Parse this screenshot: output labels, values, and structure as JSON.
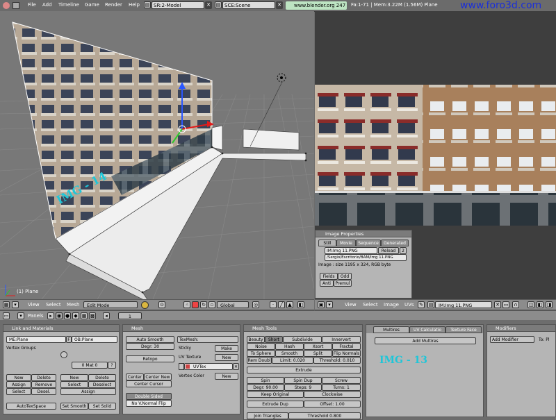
{
  "topbar": {
    "menus": [
      "File",
      "Add",
      "Timeline",
      "Game",
      "Render",
      "Help"
    ],
    "screen": "SR:2-Model",
    "scene": "SCE:Scene",
    "url": "www.blender.org 247",
    "stats": "Fa:1-71 | Mem:3.22M (1.56M) Plane",
    "watermark": "www.foro3d.com"
  },
  "view3d": {
    "overlay_text": "IMG - 14",
    "object_label": "(1) Plane",
    "header": {
      "view": "View",
      "select": "Select",
      "mesh": "Mesh",
      "mode": "Edit Mode",
      "orientation": "Global"
    }
  },
  "imageview": {
    "header": {
      "view": "View",
      "select": "Select",
      "image": "Image",
      "uvs": "UVs",
      "image_name": "IM:Img 11.PNG"
    },
    "properties": {
      "title": "Image Properties",
      "tabs": [
        "Still",
        "Movie",
        "Sequence",
        "Generated"
      ],
      "name": "IM:Img 11.PNG",
      "reload": "Reload",
      "users": "2",
      "path": "/Sergio/Escritorio/BAM/Img 11.PNG",
      "info": "Image : size 1195 x 324, RGB byte",
      "fields": "Fields",
      "odd": "Odd",
      "anti": "Anti",
      "premul": "Premul"
    }
  },
  "buttons_header": {
    "panels": "Panels",
    "frame": "1"
  },
  "link_materials": {
    "title": "Link and Materials",
    "me": "ME:Plane",
    "f": "F",
    "ob": "OB:Plane",
    "vertex_groups": "Vertex Groups",
    "mat": "0 Mat 0",
    "q": "?",
    "new": "New",
    "delete": "Delete",
    "assign": "Assign",
    "remove": "Remove",
    "select": "Select",
    "deselect": "Desel.",
    "new2": "New",
    "delete2": "Delete",
    "select2": "Select",
    "deselect2": "Deselect",
    "assign2": "Assign",
    "autotexspace": "AutoTexSpace",
    "set_smooth": "Set Smooth",
    "set_solid": "Set Solid"
  },
  "mesh": {
    "title": "Mesh",
    "auto_smooth": "Auto Smooth",
    "degr": "Degr: 30",
    "retopo": "Retopo",
    "texmesh": "TexMesh:",
    "sticky": "Sticky",
    "make": "Make",
    "uv_texture": "UV Texture",
    "new": "New",
    "uvtex": "UVTex",
    "vertex_color": "Vertex Color",
    "new2": "New",
    "center": "Center",
    "center_new": "Center New",
    "center_cursor": "Center Cursor",
    "double_sided": "Double Sided",
    "no_v_normal_flip": "No V.Normal Flip"
  },
  "mesh_tools": {
    "title": "Mesh Tools",
    "beauty": "Beauty",
    "short": "Short",
    "subdivide": "Subdivide",
    "innervert": "Innervert",
    "noise": "Noise",
    "hash": "Hash",
    "xsort": "Xsort",
    "fractal": "Fractal",
    "to_sphere": "To Sphere",
    "smooth": "Smooth",
    "split": "Split",
    "flip_normals": "Flip Normals",
    "rem_doubl": "Rem Doubl",
    "limit": "Limit: 0.020",
    "threshold": "Threshold: 0.010",
    "extrude": "Extrude",
    "spin": "Spin",
    "spin_dup": "Spin Dup",
    "screw": "Screw",
    "degr": "Degr: 90.00",
    "steps": "Steps: 9",
    "turns": "Turns: 1",
    "keep_original": "Keep Original",
    "clockwise": "Clockwise",
    "extrude_dup": "Extrude Dup",
    "offset": "Offset: 1.00",
    "join_triangles": "Join Triangles",
    "threshold2": "Threshold 0.800"
  },
  "multires": {
    "tabs": [
      "Multires",
      "UV Calculatio",
      "Texture Face"
    ],
    "add_multires": "Add Multires",
    "overlay": "IMG - 13"
  },
  "modifiers": {
    "title": "Modifiers",
    "add_modifier": "Add Modifier",
    "to": "To: Pl"
  },
  "colors": {
    "accent_overlay": "#1fc6d8",
    "watermark": "#1b2fd8"
  }
}
